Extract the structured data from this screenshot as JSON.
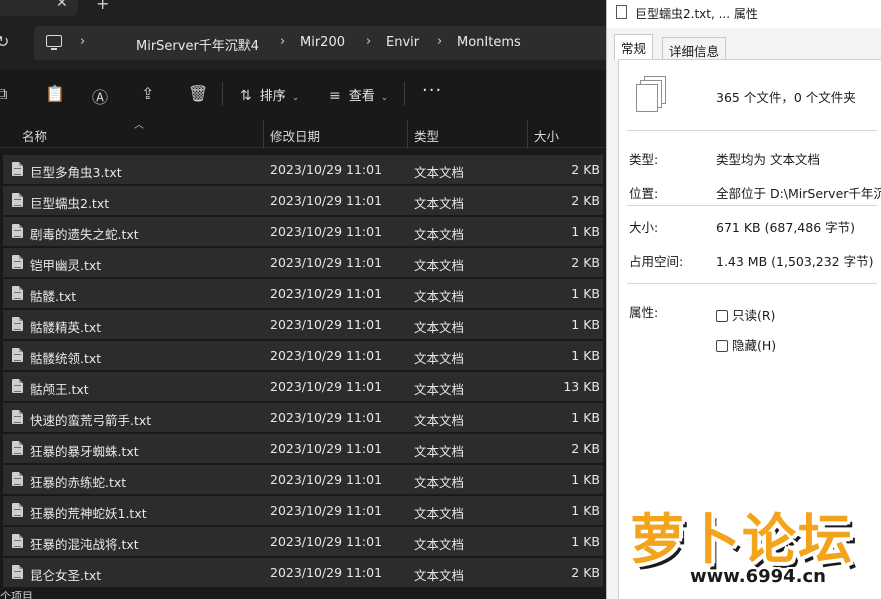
{
  "explorer": {
    "breadcrumbs": [
      "MirServer千年沉默4",
      "Mir200",
      "Envir",
      "MonItems"
    ],
    "toolbar": {
      "sort_label": "排序",
      "view_label": "查看",
      "more_label": "···"
    },
    "columns": {
      "name": "名称",
      "date": "修改日期",
      "type": "类型",
      "size": "大小"
    },
    "files": [
      {
        "name": "巨型多角虫3.txt",
        "date": "2023/10/29 11:01",
        "type": "文本文档",
        "size": "2 KB"
      },
      {
        "name": "巨型蠕虫2.txt",
        "date": "2023/10/29 11:01",
        "type": "文本文档",
        "size": "2 KB"
      },
      {
        "name": "剧毒的遗失之蛇.txt",
        "date": "2023/10/29 11:01",
        "type": "文本文档",
        "size": "1 KB"
      },
      {
        "name": "铠甲幽灵.txt",
        "date": "2023/10/29 11:01",
        "type": "文本文档",
        "size": "2 KB"
      },
      {
        "name": "骷髅.txt",
        "date": "2023/10/29 11:01",
        "type": "文本文档",
        "size": "1 KB"
      },
      {
        "name": "骷髅精英.txt",
        "date": "2023/10/29 11:01",
        "type": "文本文档",
        "size": "1 KB"
      },
      {
        "name": "骷髅统领.txt",
        "date": "2023/10/29 11:01",
        "type": "文本文档",
        "size": "1 KB"
      },
      {
        "name": "骷颅王.txt",
        "date": "2023/10/29 11:01",
        "type": "文本文档",
        "size": "13 KB"
      },
      {
        "name": "快速的蛮荒弓箭手.txt",
        "date": "2023/10/29 11:01",
        "type": "文本文档",
        "size": "1 KB"
      },
      {
        "name": "狂暴的暴牙蜘蛛.txt",
        "date": "2023/10/29 11:01",
        "type": "文本文档",
        "size": "2 KB"
      },
      {
        "name": "狂暴的赤练蛇.txt",
        "date": "2023/10/29 11:01",
        "type": "文本文档",
        "size": "1 KB"
      },
      {
        "name": "狂暴的荒神蛇妖1.txt",
        "date": "2023/10/29 11:01",
        "type": "文本文档",
        "size": "1 KB"
      },
      {
        "name": "狂暴的混沌战将.txt",
        "date": "2023/10/29 11:01",
        "type": "文本文档",
        "size": "1 KB"
      },
      {
        "name": "昆仑女圣.txt",
        "date": "2023/10/29 11:01",
        "type": "文本文档",
        "size": "2 KB"
      }
    ],
    "status_text": "个项目"
  },
  "properties": {
    "title": "巨型蠕虫2.txt, ... 属性",
    "tabs": [
      "常规",
      "详细信息"
    ],
    "file_count": "365 个文件，0 个文件夹",
    "type_label": "类型:",
    "type_value": "类型均为 文本文档",
    "location_label": "位置:",
    "location_value": "全部位于 D:\\MirServer千年沉默",
    "size_label": "大小:",
    "size_value": "671 KB (687,486 字节)",
    "disk_label": "占用空间:",
    "disk_value": "1.43 MB (1,503,232 字节)",
    "attributes_label": "属性:",
    "readonly_label": "只读(R)",
    "hidden_label": "隐藏(H)"
  },
  "watermark": {
    "text": "萝卜论坛",
    "url": "www.6994.cn"
  }
}
